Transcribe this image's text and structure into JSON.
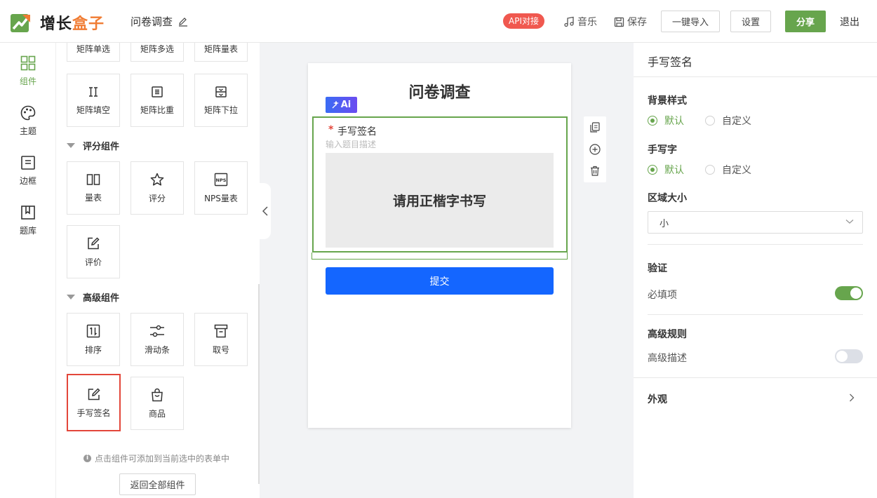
{
  "header": {
    "logo_text_1": "增长",
    "logo_text_2": "盒子",
    "doc_title": "问卷调查",
    "api_badge": "API对接",
    "music_label": "音乐",
    "save_label": "保存",
    "import_label": "一键导入",
    "settings_label": "设置",
    "share_label": "分享",
    "logout_label": "退出"
  },
  "rail": {
    "items": [
      {
        "label": "组件",
        "icon": "grid-icon",
        "active": true
      },
      {
        "label": "主题",
        "icon": "palette-icon",
        "active": false
      },
      {
        "label": "边框",
        "icon": "border-icon",
        "active": false
      },
      {
        "label": "题库",
        "icon": "library-icon",
        "active": false
      }
    ]
  },
  "panel": {
    "top_row": [
      "矩阵单选",
      "矩阵多选",
      "矩阵量表"
    ],
    "matrix_row": [
      {
        "label": "矩阵填空",
        "icon": "matrix-fill-icon"
      },
      {
        "label": "矩阵比重",
        "icon": "matrix-weight-icon"
      },
      {
        "label": "矩阵下拉",
        "icon": "matrix-dropdown-icon"
      }
    ],
    "section_rating": "评分组件",
    "rating_items": [
      {
        "label": "量表",
        "icon": "scale-icon"
      },
      {
        "label": "评分",
        "icon": "star-icon"
      },
      {
        "label": "NPS量表",
        "icon": "nps-icon"
      },
      {
        "label": "评价",
        "icon": "review-icon"
      }
    ],
    "section_advanced": "高级组件",
    "advanced_items": [
      {
        "label": "排序",
        "icon": "sort-icon"
      },
      {
        "label": "滑动条",
        "icon": "slider-icon"
      },
      {
        "label": "取号",
        "icon": "ticket-icon"
      },
      {
        "label": "手写签名",
        "icon": "signature-icon"
      },
      {
        "label": "商品",
        "icon": "shopping-bag-icon"
      }
    ],
    "hint": "点击组件可添加到当前选中的表单中",
    "back_button": "返回全部组件"
  },
  "canvas": {
    "form_title": "问卷调查",
    "ai_badge": "Ai",
    "question": {
      "required_mark": "*",
      "title": "手写签名",
      "description_placeholder": "输入题目描述",
      "sign_area_text": "请用正楷字书写"
    },
    "submit_label": "提交"
  },
  "settings": {
    "header": "手写签名",
    "bg_style_label": "背景样式",
    "bg_style_options": [
      "默认",
      "自定义"
    ],
    "bg_style_selected": "默认",
    "handwriting_label": "手写字",
    "handwriting_options": [
      "默认",
      "自定义"
    ],
    "handwriting_selected": "默认",
    "area_size_label": "区域大小",
    "area_size_value": "小",
    "validation_label": "验证",
    "required_label": "必填项",
    "required_on": true,
    "advanced_rules_label": "高级规则",
    "advanced_desc_label": "高级描述",
    "advanced_desc_on": false,
    "appearance_label": "外观"
  },
  "colors": {
    "brand_green": "#67a54d",
    "logo_orange": "#f07c33",
    "api_red": "#f0584f",
    "submit_blue": "#1466ff",
    "selected_red": "#e3463a"
  }
}
